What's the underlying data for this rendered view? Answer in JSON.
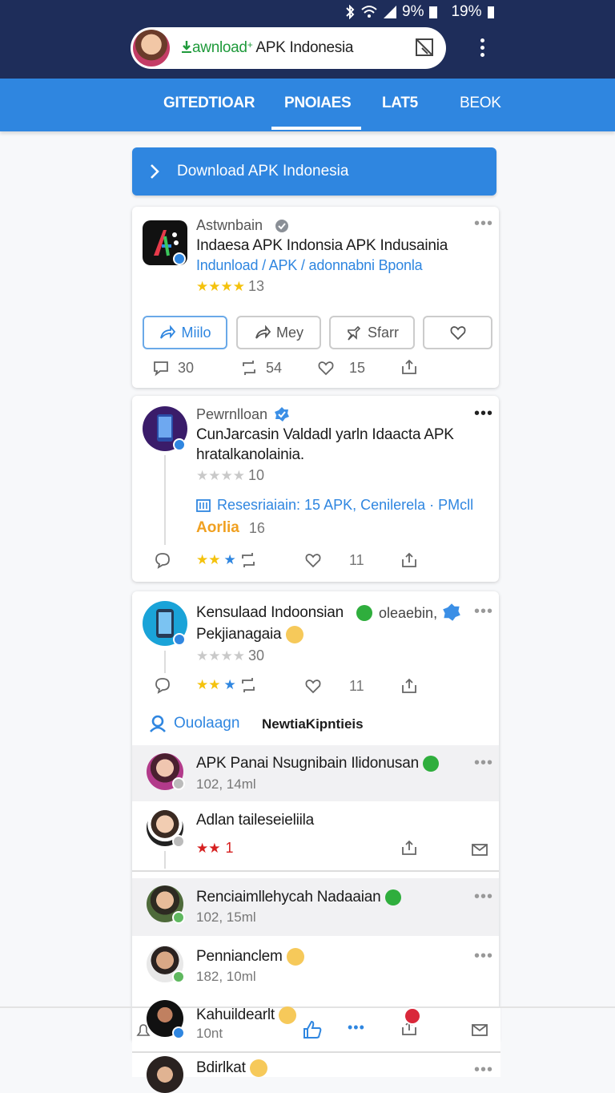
{
  "status": {
    "battery1": "9%",
    "battery2": "19%"
  },
  "header": {
    "search_green": "awnload",
    "search_rest": "APK Indonesia"
  },
  "tabs": [
    {
      "label": "GITEDTIOAR"
    },
    {
      "label": "PNOIAES"
    },
    {
      "label": "LAT5"
    },
    {
      "label": "BEOK"
    }
  ],
  "banner": {
    "label": "Download APK Indonesia"
  },
  "post1": {
    "name": "Astwnbain",
    "title": "Indaesa APK Indonsia APK Indusainia",
    "subtitle": "Indunload / APK / adonnabni Bponla",
    "rating_count": "13",
    "buttons": [
      "Miilo",
      "Mey",
      "Sfarr"
    ],
    "comments": "30",
    "reposts": "54",
    "likes": "15"
  },
  "post2": {
    "name": "Pewrnlloan",
    "title_line1": "CunJarcasin Valdadl yarln Idaacta APK",
    "title_line2": "hratalkanolainia.",
    "rating_count": "10",
    "resource": "Resesriaiain: 15 APK, Cenilerela · PMcll",
    "tag": "Aorlia",
    "tag_count": "16",
    "likes": "11"
  },
  "post3": {
    "name": "Kensulaad Indoonsian",
    "extra": "oleaebin,",
    "title": "Pekjianagaia",
    "rating_count": "30",
    "likes": "11"
  },
  "section": {
    "link": "Ouolaagn",
    "label": "NewtiaKipntieis"
  },
  "list": [
    {
      "name": "APK Panai Nsugnibain Ilidonusan",
      "meta": "102, 14ml"
    },
    {
      "name": "Adlan taileseieliila",
      "meta": "1"
    },
    {
      "name": "Renciaimllehycah Nadaaian",
      "meta": "102, 15ml"
    },
    {
      "name": "Penniancl​em",
      "meta": "182, 10ml"
    },
    {
      "name": "Kahuildearlt",
      "meta": "10nt"
    },
    {
      "name": "Bdirlkat",
      "meta": ""
    }
  ]
}
